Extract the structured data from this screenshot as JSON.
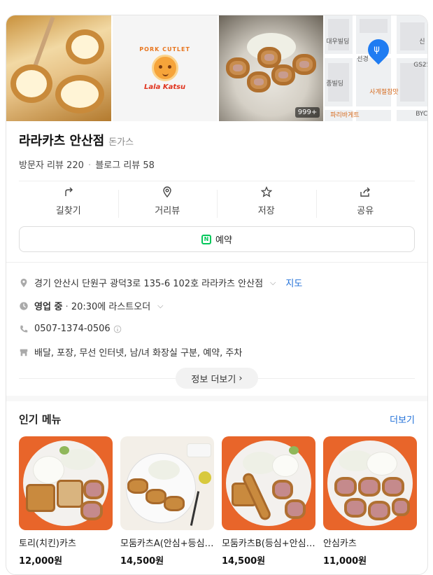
{
  "photos": {
    "logo_top": "PORK CUTLET",
    "logo_bottom": "Lala Katsu",
    "photo_count": "999+",
    "map_labels": [
      "대우빌딩",
      "선경",
      "종빌딩",
      "사계절참맛",
      "파리바게트",
      "신",
      "GS25",
      "BYC",
      "GS"
    ]
  },
  "place": {
    "name": "라라카츠 안산점",
    "category": "돈가스",
    "visitor_reviews": "방문자 리뷰 220",
    "blog_reviews": "블로그 리뷰 58"
  },
  "actions": [
    {
      "label": "길찾기",
      "icon": "directions-icon"
    },
    {
      "label": "거리뷰",
      "icon": "location-pin-icon"
    },
    {
      "label": "저장",
      "icon": "star-icon"
    },
    {
      "label": "공유",
      "icon": "share-icon"
    }
  ],
  "reserve_label": "예약",
  "details": {
    "address": "경기 안산시 단원구 광덕3로 135-6 102호 라라카츠 안산점",
    "map_link": "지도",
    "status": "영업 중",
    "status_detail": "20:30에 라스트오더",
    "phone": "0507-1374-0506",
    "amenities": "배달, 포장, 무선 인터넷, 남/녀 화장실 구분, 예약, 주차",
    "more_info": "정보 더보기"
  },
  "menu": {
    "title": "인기 메뉴",
    "more": "더보기",
    "items": [
      {
        "name": "토리(치킨)카츠",
        "price": "12,000원"
      },
      {
        "name": "모둠카츠A(안심+등심+치즈)",
        "price": "14,500원"
      },
      {
        "name": "모둠카츠B(등심+안심+새우)",
        "price": "14,500원"
      },
      {
        "name": "안심카츠",
        "price": "11,000원"
      }
    ]
  },
  "colors": {
    "link": "#1f6fd8",
    "naver_green": "#03c75a",
    "map_pin": "#1f7cf2",
    "menu_bg": "#e8652a"
  }
}
